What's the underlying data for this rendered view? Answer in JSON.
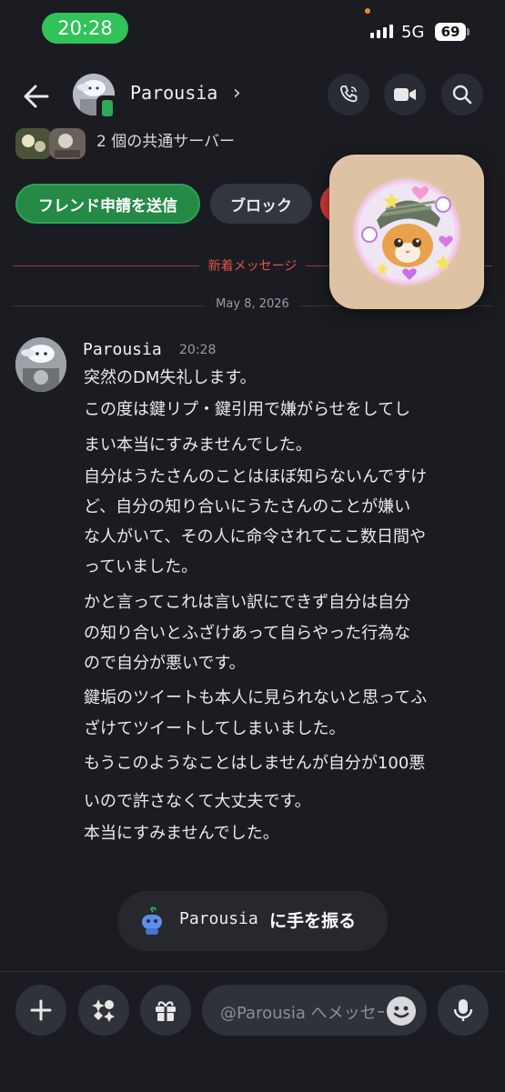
{
  "status": {
    "time": "20:28",
    "network": "5G",
    "battery": "69"
  },
  "header": {
    "name": "Parousia",
    "chevron": "›"
  },
  "profile": {
    "mutual_servers": "2 個の共通サーバー"
  },
  "actions": {
    "add_friend": "フレンド申請を送信",
    "block": "ブロック"
  },
  "divider": {
    "new_messages": "新着メッセージ",
    "date": "May 8, 2026"
  },
  "message": {
    "author": "Parousia",
    "time": "20:28",
    "lines": [
      "突然のDM失礼します。",
      "この度は鍵リプ・鍵引用で嫌がらせをしてし",
      "まい本当にすみませんでした。",
      "自分はうたさんのことはほぼ知らないんですけ",
      "ど、自分の知り合いにうたさんのことが嫌い",
      "な人がいて、その人に命令されてここ数日間や",
      "っていました。",
      "かと言ってこれは言い訳にできず自分は自分",
      "の知り合いとふざけあって自らやった行為な",
      "ので自分が悪いです。",
      "鍵垢のツイートも本人に見られないと思ってふ",
      "ざけてツイートしてしまいました。",
      "もうこのようなことはしませんが自分が100悪",
      "いので許さなくて大丈夫です。",
      "本当にすみませんでした。"
    ]
  },
  "wave": {
    "name": "Parousia",
    "text": "に手を振る"
  },
  "composer": {
    "placeholder": "@Parousia へメッセージを送信"
  },
  "colors": {
    "accent_green": "#248a46",
    "danger_red": "#d33a3a",
    "new_msg_red": "#e5534b",
    "bg": "#1b1c21"
  }
}
